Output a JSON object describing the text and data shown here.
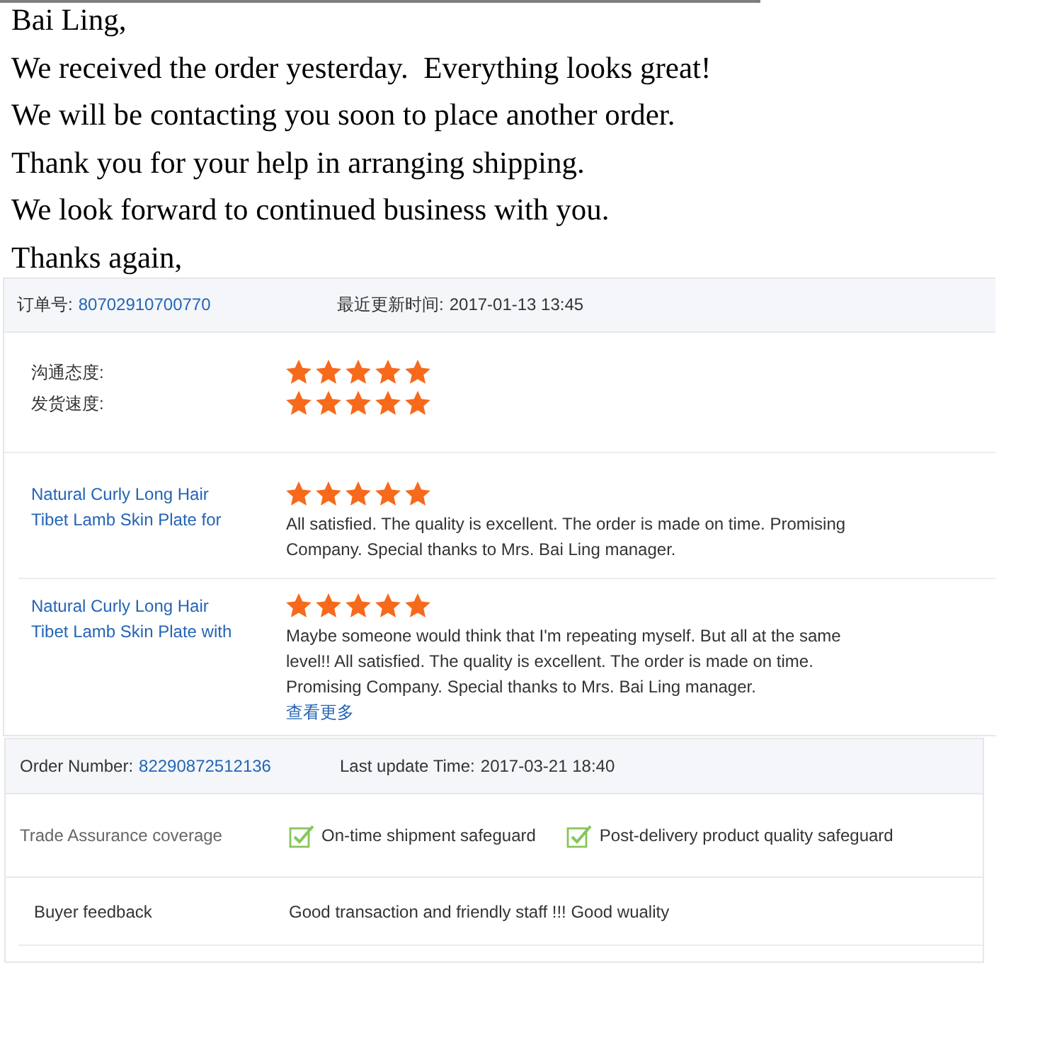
{
  "letter": {
    "lines": [
      "Bai Ling,",
      "We received the order yesterday.  Everything looks great!",
      "We will be contacting you soon to place another order.",
      "Thank you for your help in arranging shipping.",
      "We look forward to continued business with you.",
      "Thanks again,"
    ]
  },
  "order_1": {
    "order_label": "订单号:",
    "order_number": "80702910700770",
    "update_label": "最近更新时间:",
    "update_time": "2017-01-13 13:45",
    "ratings": [
      {
        "label": "沟通态度:",
        "stars": 5
      },
      {
        "label": "发货速度:",
        "stars": 5
      }
    ],
    "reviews": [
      {
        "product": "Natural Curly Long Hair Tibet Lamb Skin Plate for",
        "stars": 5,
        "text": "All satisfied. The quality is excellent. The order is made on time. Promising Company. Special thanks to Mrs. Bai Ling manager."
      },
      {
        "product": "Natural Curly Long Hair Tibet Lamb Skin Plate with",
        "stars": 5,
        "text": "Maybe someone would think that I'm repeating myself. But all at the same level!! All satisfied. The quality is excellent. The order is made on time. Promising Company. Special thanks to Mrs. Bai Ling manager.",
        "more_link": "查看更多"
      }
    ]
  },
  "order_2": {
    "order_label": "Order Number:",
    "order_number": "82290872512136",
    "update_label": "Last update Time:",
    "update_time": "2017-03-21 18:40",
    "assurance": {
      "label": "Trade Assurance coverage",
      "items": [
        {
          "label": "On-time shipment safeguard",
          "checked": true
        },
        {
          "label": "Post-delivery product quality safeguard",
          "checked": true
        }
      ]
    },
    "feedback": {
      "label": "Buyer feedback",
      "text": "Good transaction and friendly staff !!! Good wuality"
    }
  }
}
